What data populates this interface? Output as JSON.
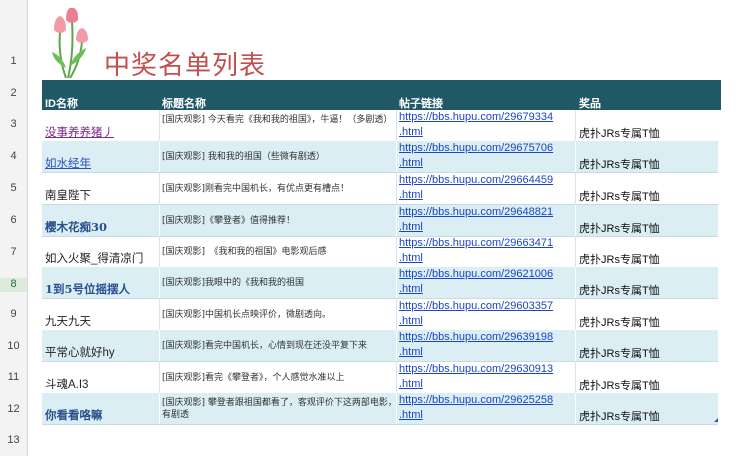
{
  "sheet": {
    "title": "中奖名单列表",
    "row_numbers": [
      "1",
      "2",
      "3",
      "4",
      "5",
      "6",
      "7",
      "8",
      "9",
      "10",
      "11",
      "12",
      "13"
    ],
    "headers": [
      "ID名称",
      "标题名称",
      "帖子链接",
      "奖品"
    ],
    "rows": [
      {
        "id": "没事养养猪丿",
        "title": "[国庆观影] 今天看完《我和我的祖国》，牛逼！（多剧透）",
        "link1": "https://bbs.hupu.com/29679334",
        ".html": "",
        "link2": ".html",
        "prize": "虎扑JRs专属T恤"
      },
      {
        "id": "如水经年",
        "title": "[国庆观影] 我和我的祖国（些微有剧透）",
        "link1": "https://bbs.hupu.com/29675706",
        "link2": ".html",
        "prize": "虎扑JRs专属T恤"
      },
      {
        "id": "南皇陛下",
        "title": "[国庆观影]刚看完中国机长，有优点更有槽点！",
        "link1": "https://bbs.hupu.com/29664459",
        "link2": ".html",
        "prize": "虎扑JRs专属T恤"
      },
      {
        "id": "樱木花痴30",
        "title": "[国庆观影]《攀登者》值得推荐！",
        "link1": "https://bbs.hupu.com/29648821",
        "link2": ".html",
        "prize": "虎扑JRs专属T恤"
      },
      {
        "id": "如入火聚_得清凉门",
        "title": "[国庆观影]　《我和我的祖国》电影观后感",
        "link1": "https://bbs.hupu.com/29663471",
        "link2": ".html",
        "prize": "虎扑JRs专属T恤"
      },
      {
        "id": "1到5号位摇摆人",
        "title": "[国庆观影]我眼中的《我和我的祖国",
        "link1": "https://bbs.hupu.com/29621006",
        "link2": ".html",
        "prize": "虎扑JRs专属T恤"
      },
      {
        "id": "九天九天",
        "title": "[国庆观影]中国机长点映评价，微剧透向。",
        "link1": "https://bbs.hupu.com/29603357",
        "link2": ".html",
        "prize": "虎扑JRs专属T恤"
      },
      {
        "id": "平常心就好hy",
        "title": "[国庆观影]看完中国机长，心情到现在还没平复下来",
        "link1": "https://bbs.hupu.com/29639198",
        "link2": ".html",
        "prize": "虎扑JRs专属T恤"
      },
      {
        "id": "斗魂A.I3",
        "title": "[国庆观影]看完《攀登者》，个人感觉水准以上",
        "link1": "https://bbs.hupu.com/29630913",
        "link2": ".html",
        "prize": "虎扑JRs专属T恤"
      },
      {
        "id": "你看看咯嘛",
        "title": "[国庆观影] 攀登者跟祖国都看了，客观评价下这两部电影，有剧透",
        "link1": "https://bbs.hupu.com/29625258",
        "link2": ".html",
        "prize": "虎扑JRs专属T恤"
      }
    ],
    "id_styles": [
      {
        "color": "#7a2a8a",
        "underline": true,
        "bold": false
      },
      {
        "color": "#2a4fbf",
        "underline": true,
        "bold": false
      },
      {
        "color": "#222222",
        "underline": false,
        "bold": false
      },
      {
        "color": "#2a4f8f",
        "underline": false,
        "bold": true
      },
      {
        "color": "#222222",
        "underline": false,
        "bold": false
      },
      {
        "color": "#2a4f8f",
        "underline": false,
        "bold": true
      },
      {
        "color": "#222222",
        "underline": false,
        "bold": false
      },
      {
        "color": "#222222",
        "underline": false,
        "bold": false
      },
      {
        "color": "#222222",
        "underline": false,
        "bold": false
      },
      {
        "color": "#2a4f8f",
        "underline": false,
        "bold": true
      }
    ],
    "colors": {
      "header_bg": "#215866",
      "alt_row": "#daeef3",
      "title": "#c0504d",
      "link": "#1b45c8"
    }
  }
}
